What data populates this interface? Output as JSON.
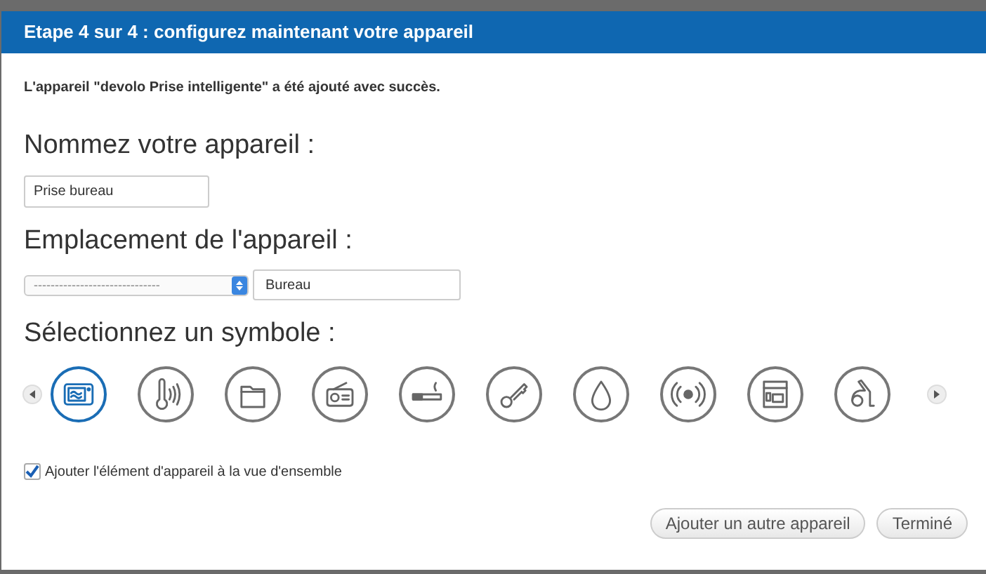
{
  "window": {
    "title": "Etape 4 sur 4 : configurez maintenant votre appareil"
  },
  "message": "L'appareil \"devolo Prise intelligente\" a été ajouté avec succès.",
  "name_section": {
    "heading": "Nommez votre appareil :",
    "value": "Prise bureau"
  },
  "location_section": {
    "heading": "Emplacement de l'appareil :",
    "select_value": "------------------------------",
    "value": "Bureau"
  },
  "symbol_section": {
    "heading": "Sélectionnez un symbole :",
    "symbols": [
      {
        "kind": "microwave",
        "selected": true
      },
      {
        "kind": "thermometer",
        "selected": false
      },
      {
        "kind": "folder",
        "selected": false
      },
      {
        "kind": "radio",
        "selected": false
      },
      {
        "kind": "cigarette",
        "selected": false
      },
      {
        "kind": "key",
        "selected": false
      },
      {
        "kind": "drop",
        "selected": false
      },
      {
        "kind": "siren",
        "selected": false
      },
      {
        "kind": "dishwasher",
        "selected": false
      },
      {
        "kind": "vacuum",
        "selected": false
      }
    ]
  },
  "overview_checkbox": {
    "label": "Ajouter l'élément d'appareil à la vue d'ensemble",
    "checked": true
  },
  "buttons": [
    "Ajouter un autre appareil",
    "Terminé"
  ]
}
